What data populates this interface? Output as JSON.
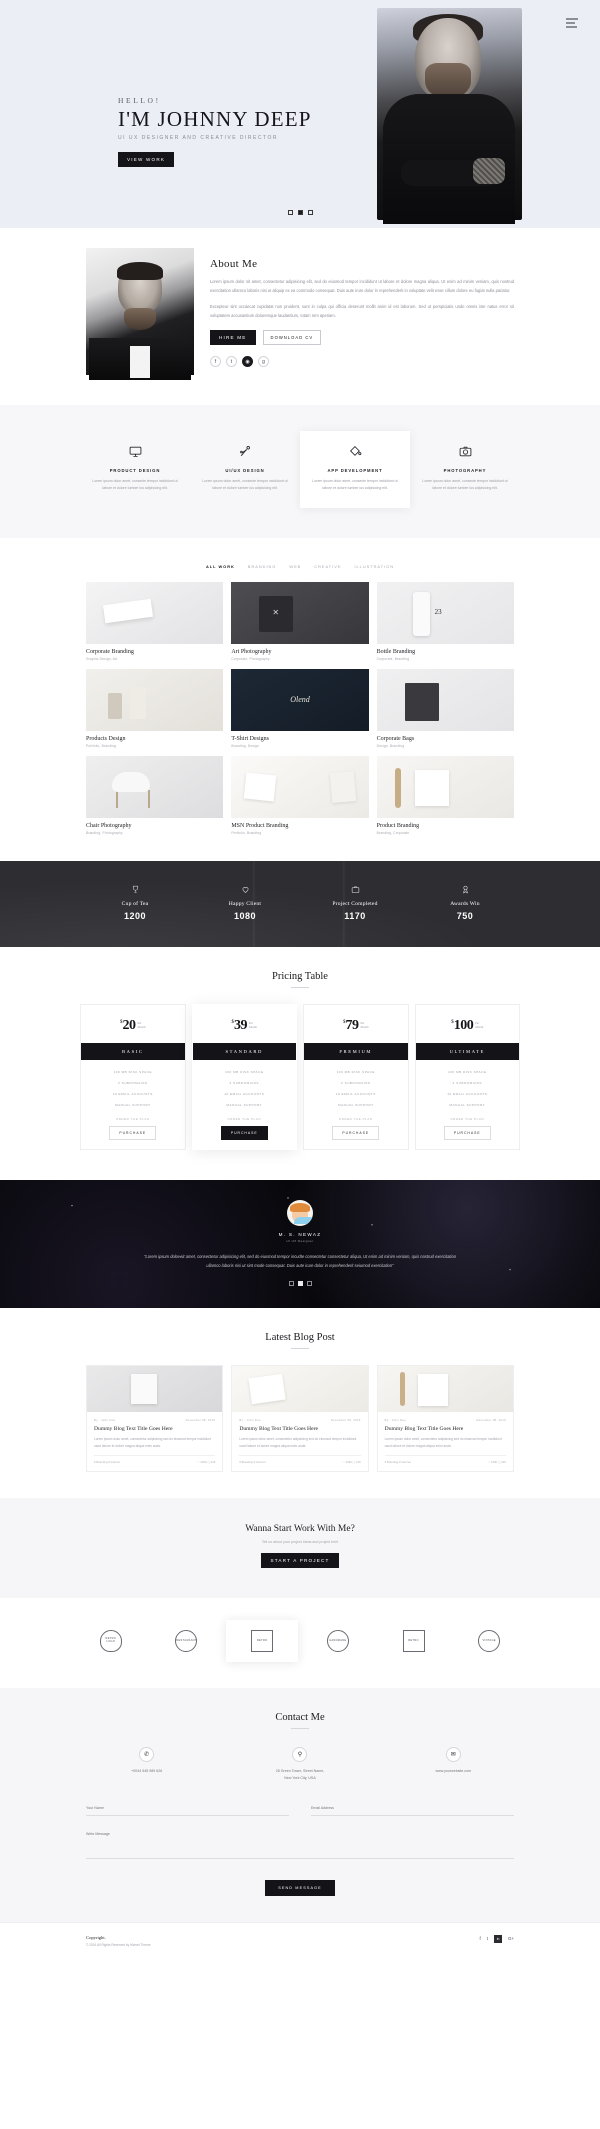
{
  "hero": {
    "hello": "HELLO!",
    "name": "I'M  JOHNNY DEEP",
    "subtitle": "UI UX DESIGNER AND CREATIVE DIRECTOR",
    "cta": "VIEW WORK",
    "menu_icon": "hamburger-icon"
  },
  "about": {
    "title": "About Me",
    "paragraph": "Lorem ipsum dolor sit amet, consectetur adipisicing elit, sed do eiusmod tempor incididunt ut labore et dolore magna aliqua. Ut enim ad minim veniam, quis nostrud exercitation ullamco laboris nisi ut aliquip ex ea commodo consequat. Duis aute irure dolor in reprehenderit in voluptate velit esse cillum dolore eu fugiat nulla pariatur.",
    "paragraph2": "Excepteur sint occaecat cupidatat non proident, sunt in culpa qui officia deserunt mollit anim id est laborum. Sed ut perspiciatis unde omnis iste natus error sit voluptatem accusantium doloremque laudantium, totam rem aperiam.",
    "btn_primary": "HIRE ME",
    "btn_secondary": "DOWNLOAD CV",
    "socials": [
      "facebook",
      "twitter",
      "instagram",
      "google-plus"
    ]
  },
  "services": [
    {
      "icon": "monitor-icon",
      "title": "PRODUCT DESIGN",
      "desc": "Lorem ipsum dolor amet, consecte tempor incididunt ut labore et dolore tumber ius adipisicing elit.",
      "active": false
    },
    {
      "icon": "pen-tool-icon",
      "title": "UI/UX DESIGN",
      "desc": "Lorem ipsum dolor amet, consecte tempor incididunt ut labore et dolore tumber ius adipisicing elit.",
      "active": false
    },
    {
      "icon": "paint-bucket-icon",
      "title": "APP DEVELOPMENT",
      "desc": "Lorem ipsum dolor amet, consecte tempor incididunt ut labore et dolore tumber ius adipisicing elit.",
      "active": true
    },
    {
      "icon": "camera-icon",
      "title": "PHOTOGRAPHY",
      "desc": "Lorem ipsum dolor amet, consecte tempor incididunt ut labore et dolore tumber ius adipisicing elit.",
      "active": false
    }
  ],
  "portfolio": {
    "filters": [
      {
        "label": "ALL WORK",
        "active": true
      },
      {
        "label": "BRANDING",
        "active": false
      },
      {
        "label": "WEB",
        "active": false
      },
      {
        "label": "CREATIVE",
        "active": false
      },
      {
        "label": "ILLUSTRATION",
        "active": false
      }
    ],
    "items": [
      {
        "title": "Corporate Branding",
        "sub": "Graphic Design, Art",
        "thumb": "t1"
      },
      {
        "title": "Art Photography",
        "sub": "Corporate, Photography",
        "thumb": "t2"
      },
      {
        "title": "Bottle Branding",
        "sub": "Corporate, Branding",
        "thumb": "t3"
      },
      {
        "title": "Products Design",
        "sub": "Portfolio, Branding",
        "thumb": "t4"
      },
      {
        "title": "T-Shirt Designs",
        "sub": "Branding, Design",
        "thumb": "t5"
      },
      {
        "title": "Corporate Bags",
        "sub": "Design, Branding",
        "thumb": "t6"
      },
      {
        "title": "Chair Photography",
        "sub": "Branding, Photography",
        "thumb": "t7"
      },
      {
        "title": "MSN Product Branding",
        "sub": "Portfolio, Branding",
        "thumb": "t8"
      },
      {
        "title": "Product Branding",
        "sub": "Branding, Corporate",
        "thumb": "t9"
      }
    ]
  },
  "counters": [
    {
      "icon": "trophy-icon",
      "label": "Cup of Tea",
      "value": "1200"
    },
    {
      "icon": "heart-icon",
      "label": "Happy Client",
      "value": "1080"
    },
    {
      "icon": "briefcase-icon",
      "label": "Project Completed",
      "value": "1170"
    },
    {
      "icon": "award-icon",
      "label": "Awards Win",
      "value": "750"
    }
  ],
  "pricing": {
    "title": "Pricing Table",
    "plans": [
      {
        "currency": "$",
        "amount": "20",
        "per1": "Per",
        "per2": "Month",
        "name": "BASIC",
        "features": [
          "100 MB DISK SPACE",
          "2 SUBDOMAINS",
          "10 EMAIL ACCOUNTS",
          "MANUAL SUPPORT"
        ],
        "order_label": "ORDER THE PLAN",
        "buy": "PURCHASE",
        "highlight": false
      },
      {
        "currency": "$",
        "amount": "39",
        "per1": "Per",
        "per2": "Month",
        "name": "STANDARD",
        "features": [
          "100 MB DISK SPACE",
          "2 SUBDOMAINS",
          "10 EMAIL ACCOUNTS",
          "MANUAL SUPPORT"
        ],
        "order_label": "ORDER THE PLAN",
        "buy": "PURCHASE",
        "highlight": true
      },
      {
        "currency": "$",
        "amount": "79",
        "per1": "Per",
        "per2": "Month",
        "name": "PREMIUM",
        "features": [
          "100 MB DISK SPACE",
          "2 SUBDOMAINS",
          "10 EMAIL ACCOUNTS",
          "MANUAL SUPPORT"
        ],
        "order_label": "ORDER THE PLAN",
        "buy": "PURCHASE",
        "highlight": false
      },
      {
        "currency": "$",
        "amount": "100",
        "per1": "Per",
        "per2": "Month",
        "name": "ULTIMATE",
        "features": [
          "100 MB DISK SPACE",
          "2 SUBDOMAINS",
          "10 EMAIL ACCOUNTS",
          "MANUAL SUPPORT"
        ],
        "order_label": "ORDER THE PLAN",
        "buy": "PURCHASE",
        "highlight": false
      }
    ]
  },
  "testimonial": {
    "name": "M. S. NEWAZ",
    "role": "UI UX Designer",
    "quote": "\"Lorem ipsum dolor sit amet, consectetur adipisicing elit, sed do eiusmod tempor incudte consectetur consectetur aliqua, Ut enim ad minim veniam, quis nostrud exercitation ullamco laboris nisi ut sint mode consequat. Duis aute irure dolor in reprehenderit seiumod exercitation\"",
    "dots": 3,
    "active_dot": 1
  },
  "blog": {
    "title": "Latest Blog Post",
    "posts": [
      {
        "author": "By : John Doe",
        "date": "December 08, 2016",
        "title": "Dummy Blog Text Title Goes Here",
        "excerpt": "Lorem ipsum dolor amet, consectetur adipisicing sed do eiusmod tempor incididunt uaod labore et dolore magna aliqua enim auda.",
        "tag": "# Branding # Internet",
        "likes": "1290",
        "comments": "215",
        "thumb": "b1"
      },
      {
        "author": "By : John Doe",
        "date": "December 08, 2016",
        "title": "Dummy Blog Text Title Goes Here",
        "excerpt": "Lorem ipsum dolor amet, consectetur adipisicing sed do eiusmod tempor incididunt uaod labore et dolore magna aliqua enim auda.",
        "tag": "# Branding # Internet",
        "likes": "1290",
        "comments": "215",
        "thumb": "b2"
      },
      {
        "author": "By : John Doe",
        "date": "December 08, 2016",
        "title": "Dummy Blog Text Title Goes Here",
        "excerpt": "Lorem ipsum dolor amet, consectetur adipisicing sed do eiusmod tempor incididunt uaod labore et dolore magna aliqua enim auda.",
        "tag": "# Branding # Internet",
        "likes": "1290",
        "comments": "215",
        "thumb": "b3"
      }
    ]
  },
  "cta": {
    "title": "Wanna Start Work With Me?",
    "sub": "Tell us about your project ideas and project brief",
    "button": "START A PROJECT"
  },
  "clients": [
    {
      "name": "RETRO LOGO",
      "shape": "shield",
      "active": false
    },
    {
      "name": "RESTAURANT",
      "shape": "circle",
      "active": false
    },
    {
      "name": "RETRO",
      "shape": "square",
      "active": true
    },
    {
      "name": "HANDMADE",
      "shape": "circle",
      "active": false
    },
    {
      "name": "RETRO",
      "shape": "square",
      "active": false
    },
    {
      "name": "VINTAGE",
      "shape": "circle",
      "active": false
    }
  ],
  "contact": {
    "title": "Contact Me",
    "cards": [
      {
        "icon": "phone-icon",
        "text": "+0044 545 989 626"
      },
      {
        "icon": "location-pin-icon",
        "text": "28 Green Tower, Street Name,\nNew York City, USA"
      },
      {
        "icon": "envelope-icon",
        "text": "www.yourwebsite.com"
      }
    ],
    "form": {
      "name_placeholder": "Your Name",
      "email_placeholder": "Email Address",
      "message_placeholder": "Write Message",
      "submit": "SEND MESSAGE"
    }
  },
  "footer": {
    "copyright": "Copyright.",
    "line": "© 2016 All Rights Reserved by Marvel Theme",
    "socials": [
      "f",
      "t",
      "in",
      "G+"
    ]
  }
}
